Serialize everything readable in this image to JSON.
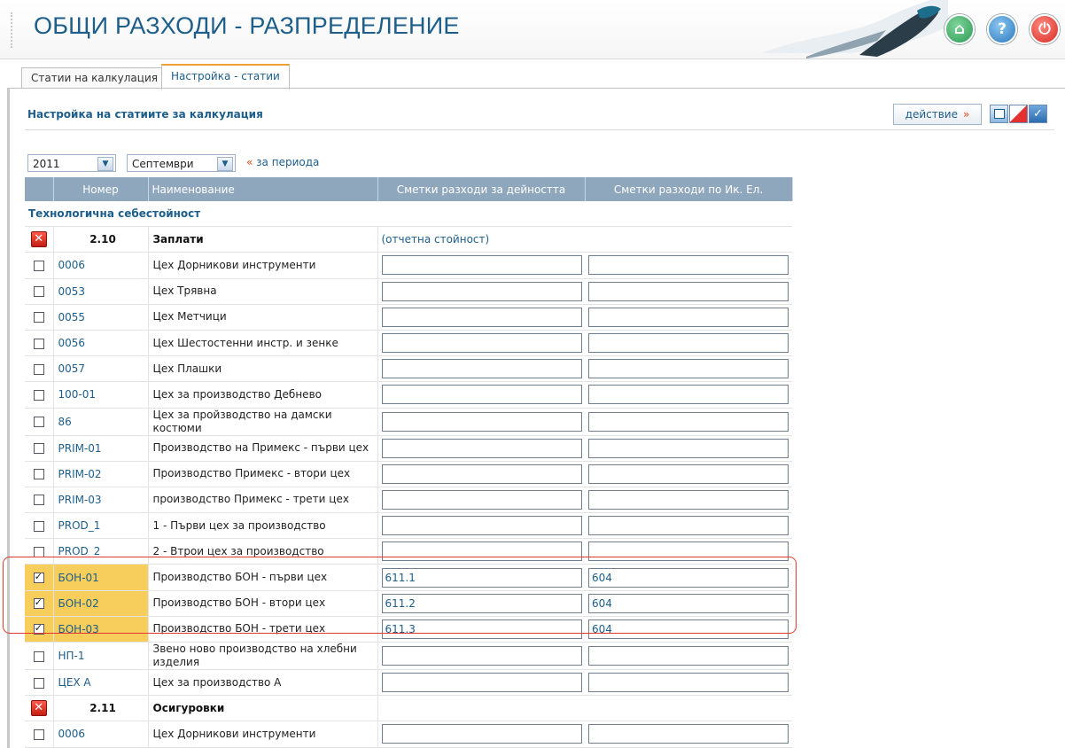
{
  "header": {
    "title": "ОБЩИ РАЗХОДИ - РАЗПРЕДЕЛЕНИЕ",
    "home_icon": "home-icon",
    "help_icon": "help-icon",
    "power_icon": "power-icon"
  },
  "tabs": [
    {
      "label": "Статии на калкулация"
    },
    {
      "label": "Настройка - статии"
    }
  ],
  "section": {
    "title": "Настройка на статиите за калкулация",
    "action_label": "действие",
    "action_mark": "»"
  },
  "filters": {
    "year": "2011",
    "month": "Септември",
    "period_link": "за периода",
    "period_mark": "«"
  },
  "table": {
    "headers": [
      "",
      "Номер",
      "Наименование",
      "Сметки разходи за дейността",
      "Сметки разходи по Ик. Ел."
    ],
    "group": "Технологична себестойност",
    "head1": {
      "num": "2.10",
      "name": "Заплати",
      "ref": "(отчетна стойност)"
    },
    "rows1": [
      {
        "code": "0006",
        "name": "Цех Дорникови инструменти",
        "a": "",
        "b": "",
        "checked": false
      },
      {
        "code": "0053",
        "name": "Цех Трявна",
        "a": "",
        "b": "",
        "checked": false
      },
      {
        "code": "0055",
        "name": "Цех Метчици",
        "a": "",
        "b": "",
        "checked": false
      },
      {
        "code": "0056",
        "name": "Цех Шестостенни инстр. и зенке",
        "a": "",
        "b": "",
        "checked": false
      },
      {
        "code": "0057",
        "name": "Цех Плашки",
        "a": "",
        "b": "",
        "checked": false
      },
      {
        "code": "100-01",
        "name": "Цех за производство Дебнево",
        "a": "",
        "b": "",
        "checked": false
      },
      {
        "code": "86",
        "name": "Цех за пройзводство на дамски костюми",
        "a": "",
        "b": "",
        "checked": false
      },
      {
        "code": "PRIM-01",
        "name": "Производство на Примекс - първи цех",
        "a": "",
        "b": "",
        "checked": false
      },
      {
        "code": "PRIM-02",
        "name": "Производство Примекс - втори цех",
        "a": "",
        "b": "",
        "checked": false
      },
      {
        "code": "PRIM-03",
        "name": "производство Примекс - трети цех",
        "a": "",
        "b": "",
        "checked": false
      },
      {
        "code": "PROD_1",
        "name": "1 - Първи цех за производство",
        "a": "",
        "b": "",
        "checked": false
      },
      {
        "code": "PROD_2",
        "name": "2 - Втрои цех за производство",
        "a": "",
        "b": "",
        "checked": false
      },
      {
        "code": "БОН-01",
        "name": "Производство БОН - първи цех",
        "a": "611.1",
        "b": "604",
        "checked": true
      },
      {
        "code": "БОН-02",
        "name": "Производство БОН - втори цех",
        "a": "611.2",
        "b": "604",
        "checked": true
      },
      {
        "code": "БОН-03",
        "name": "Производство БОН - трети цех",
        "a": "611.3",
        "b": "604",
        "checked": true
      },
      {
        "code": "НП-1",
        "name": "Звено ново производство на хлебни изделия",
        "a": "",
        "b": "",
        "checked": false
      },
      {
        "code": "ЦЕХ А",
        "name": "Цех за производство А",
        "a": "",
        "b": "",
        "checked": false
      }
    ],
    "head2": {
      "num": "2.11",
      "name": "Осигуровки"
    },
    "rows2": [
      {
        "code": "0006",
        "name": "Цех Дорникови инструменти",
        "a": "",
        "b": "",
        "checked": false
      }
    ]
  }
}
